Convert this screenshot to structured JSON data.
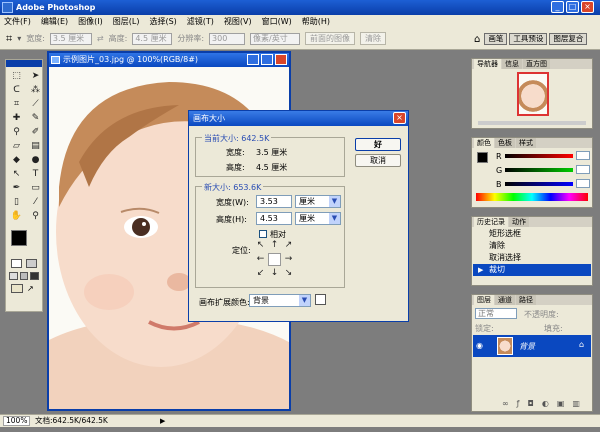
{
  "app": {
    "title": "Adobe Photoshop"
  },
  "menu": [
    "文件(F)",
    "编辑(E)",
    "图像(I)",
    "图层(L)",
    "选择(S)",
    "滤镜(T)",
    "视图(V)",
    "窗口(W)",
    "帮助(H)"
  ],
  "options": {
    "width_label": "宽度:",
    "width_value": "3.5 厘米",
    "height_label": "高度:",
    "height_value": "4.5 厘米",
    "resolution_label": "分辨率:",
    "resolution_value": "300",
    "unit_value": "像素/英寸",
    "front_image_label": "前面的图像",
    "clear_label": "清除",
    "tabs": [
      "画笔",
      "工具预设",
      "图层复合"
    ]
  },
  "document": {
    "title": "示例图片_03.jpg @ 100%(RGB/8#)"
  },
  "dialog": {
    "title": "画布大小",
    "current_legend": "当前大小: 642.5K",
    "current_width_label": "宽度:",
    "current_width_value": "3.5 厘米",
    "current_height_label": "高度:",
    "current_height_value": "4.5 厘米",
    "new_legend": "新大小: 653.6K",
    "new_width_label": "宽度(W):",
    "new_width_value": "3.53",
    "new_width_unit": "厘米",
    "new_height_label": "高度(H):",
    "new_height_value": "4.53",
    "new_height_unit": "厘米",
    "relative_label": "相对",
    "anchor_label": "定位:",
    "extension_label": "画布扩展颜色:",
    "extension_value": "背景",
    "ok_label": "好",
    "cancel_label": "取消"
  },
  "navigator": {
    "tabs": [
      "导航器",
      "信息",
      "直方图"
    ]
  },
  "color_panel": {
    "tabs": [
      "颜色",
      "色板",
      "样式"
    ],
    "channels": [
      "R",
      "G",
      "B"
    ],
    "values": [
      "",
      "",
      ""
    ]
  },
  "history": {
    "tabs": [
      "历史记录",
      "动作"
    ],
    "items": [
      "矩形选框",
      "清除",
      "取消选择",
      "裁切"
    ],
    "selected_index": 3
  },
  "layers": {
    "tabs": [
      "图层",
      "通道",
      "路径"
    ],
    "blend_mode": "正常",
    "opacity_label": "不透明度:",
    "lock_label": "锁定:",
    "fill_label": "填充:",
    "layer_name": "背景"
  },
  "status": {
    "zoom": "100%",
    "doc_info": "文档:642.5K/642.5K"
  },
  "colors": {
    "accent": "#0a3ea9",
    "chrome": "#ece9d8",
    "workspace": "#7d7d7d"
  }
}
